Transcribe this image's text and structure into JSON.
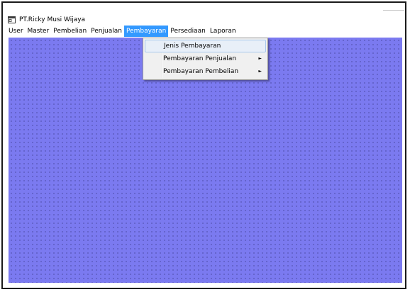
{
  "window": {
    "title": "PT.Ricky Musi Wijaya",
    "icon": "app-window-icon"
  },
  "menubar": {
    "items": [
      {
        "label": "User"
      },
      {
        "label": "Master"
      },
      {
        "label": "Pembelian"
      },
      {
        "label": "Penjualan"
      },
      {
        "label": "Pembayaran",
        "active": true
      },
      {
        "label": "Persediaan"
      },
      {
        "label": "Laporan"
      }
    ]
  },
  "dropdown": {
    "items": [
      {
        "label": "Jenis Pembayaran",
        "highlighted": true,
        "submenu": false
      },
      {
        "label": "Pembayaran Penjualan",
        "submenu": true
      },
      {
        "label": "Pembayaran Pembelian",
        "submenu": true
      }
    ],
    "arrow": "►"
  },
  "colors": {
    "workspace": "#7b7af0",
    "menu_active": "#3399ff",
    "menu_hover": "#e8eff8"
  }
}
